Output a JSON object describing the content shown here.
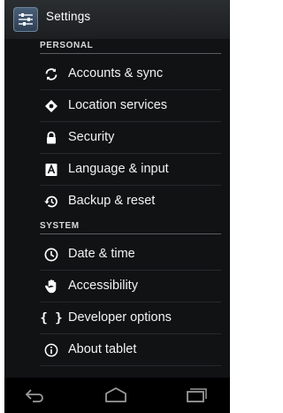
{
  "header": {
    "title": "Settings",
    "icon": "settings-sliders-icon"
  },
  "sections": [
    {
      "label": "PERSONAL",
      "items": [
        {
          "label": "Accounts & sync",
          "icon": "sync-icon"
        },
        {
          "label": "Location services",
          "icon": "location-icon"
        },
        {
          "label": "Security",
          "icon": "lock-icon"
        },
        {
          "label": "Language & input",
          "icon": "keyboard-a-icon"
        },
        {
          "label": "Backup & reset",
          "icon": "backup-restore-icon"
        }
      ]
    },
    {
      "label": "SYSTEM",
      "items": [
        {
          "label": "Date & time",
          "icon": "clock-icon"
        },
        {
          "label": "Accessibility",
          "icon": "hand-icon"
        },
        {
          "label": "Developer options",
          "icon": "braces-icon",
          "glyph": "{ }"
        },
        {
          "label": "About tablet",
          "icon": "info-icon"
        }
      ]
    }
  ],
  "navbar": {
    "buttons": [
      "back-icon",
      "home-icon",
      "recent-apps-icon"
    ]
  },
  "colors": {
    "background": "#111214",
    "actionbar": "#1c1e20",
    "text": "#f2f2f2",
    "nav": "#000000"
  }
}
